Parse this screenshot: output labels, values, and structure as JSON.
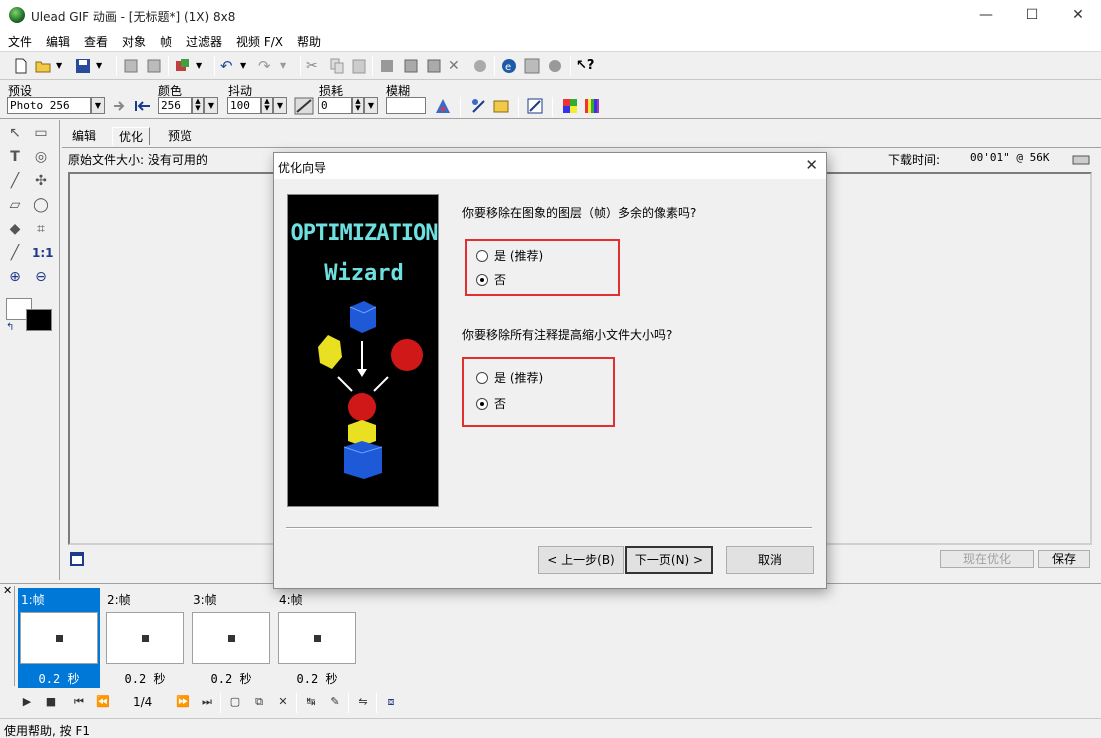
{
  "window": {
    "title": "Ulead GIF 动画 - [无标题*] (1X) 8x8",
    "minimize": "—",
    "maximize": "☐",
    "close": "✕"
  },
  "menu": [
    "文件",
    "编辑",
    "查看",
    "对象",
    "帧",
    "过滤器",
    "视频 F/X",
    "帮助"
  ],
  "options": {
    "preset_label": "预设",
    "preset_value": "Photo 256",
    "colors_label": "颜色",
    "colors_value": "256",
    "dither_label": "抖动",
    "dither_value": "100",
    "loss_label": "损耗",
    "loss_value": "0",
    "blur_label": "模糊",
    "blur_value": ""
  },
  "tabs": [
    "编辑",
    "优化",
    "预览"
  ],
  "info": {
    "original_size": "原始文件大小: 没有可用的",
    "download_time_label": "下载时间:",
    "download_time_value": "00'01\" @ 56K"
  },
  "workarea_buttons": {
    "optimize_now": "现在优化",
    "save": "保存"
  },
  "frames": [
    {
      "label": "1:帧",
      "time": "0.2 秒",
      "selected": true
    },
    {
      "label": "2:帧",
      "time": "0.2 秒",
      "selected": false
    },
    {
      "label": "3:帧",
      "time": "0.2 秒",
      "selected": false
    },
    {
      "label": "4:帧",
      "time": "0.2 秒",
      "selected": false
    }
  ],
  "playback": {
    "frame_counter": "1/4"
  },
  "status": "使用帮助, 按 F1",
  "dialog": {
    "title": "优化向导",
    "wizard_line1": "OPTIMIZATION",
    "wizard_line2": "Wizard",
    "question1": "你要移除在图象的图层（帧）多余的像素吗?",
    "q1_yes": "是 (推荐)",
    "q1_no": "否",
    "q1_selected": "no",
    "question2": "你要移除所有注释提高缩小文件大小吗?",
    "q2_yes": "是 (推荐)",
    "q2_no": "否",
    "q2_selected": "no",
    "back_button": "< 上一步(B)",
    "next_button": "下一页(N) >",
    "cancel_button": "取消"
  },
  "colors": {
    "accent": "#0078d7",
    "highlight_box": "#e03030",
    "wizard_text": "#6fe0e0"
  }
}
